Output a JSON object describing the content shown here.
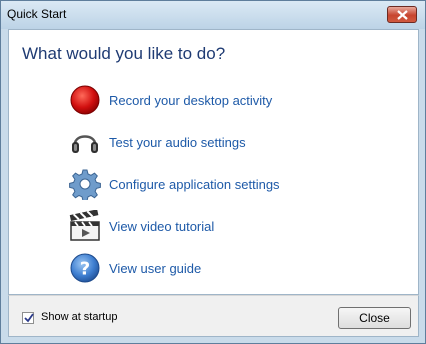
{
  "window": {
    "title": "Quick Start"
  },
  "main": {
    "heading": "What would you like to do?",
    "items": [
      {
        "label": "Record your desktop activity",
        "icon": "record-icon"
      },
      {
        "label": "Test your audio settings",
        "icon": "headphones-icon"
      },
      {
        "label": "Configure application settings",
        "icon": "gear-icon"
      },
      {
        "label": "View video tutorial",
        "icon": "clapperboard-icon"
      },
      {
        "label": "View user guide",
        "icon": "help-icon"
      }
    ]
  },
  "footer": {
    "show_at_startup_label": "Show at startup",
    "show_at_startup_checked": true,
    "close_label": "Close"
  },
  "colors": {
    "link": "#1e5aa8",
    "heading": "#1f3b73",
    "record_red": "#cc0000",
    "help_blue": "#3f7fd1"
  }
}
